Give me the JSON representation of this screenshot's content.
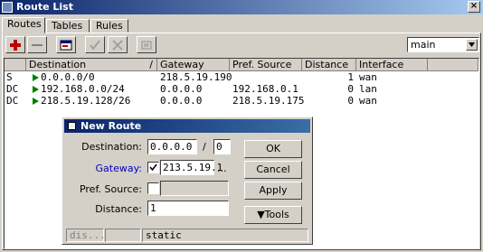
{
  "window": {
    "title": "Route List"
  },
  "tabs": [
    {
      "label": "Routes"
    },
    {
      "label": "Tables"
    },
    {
      "label": "Rules"
    }
  ],
  "toolbar": {
    "filter_value": "main"
  },
  "table": {
    "columns": [
      "Destination",
      "Gateway",
      "Pref. Source",
      "Distance",
      "Interface"
    ],
    "rows": [
      {
        "flag": "S",
        "destination": "0.0.0.0/0",
        "gateway": "218.5.19.190",
        "pref_source": "",
        "distance": "1",
        "interface": "wan"
      },
      {
        "flag": "DC",
        "destination": "192.168.0.0/24",
        "gateway": "0.0.0.0",
        "pref_source": "192.168.0.1",
        "distance": "0",
        "interface": "lan"
      },
      {
        "flag": "DC",
        "destination": "218.5.19.128/26",
        "gateway": "0.0.0.0",
        "pref_source": "218.5.19.175",
        "distance": "0",
        "interface": "wan"
      }
    ]
  },
  "dialog": {
    "title": "New Route",
    "destination_label": "Destination:",
    "destination_ip": "0.0.0.0",
    "destination_slash": "/",
    "destination_mask": "0",
    "gateway_label": "Gateway:",
    "gateway_value": "213.5.19.1",
    "gateway_more": "...",
    "pref_source_label": "Pref. Source:",
    "pref_source_value": "",
    "distance_label": "Distance:",
    "distance_value": "1",
    "ok_label": "OK",
    "cancel_label": "Cancel",
    "apply_label": "Apply",
    "tools_label": "▼Tools",
    "status_left": "dis...",
    "status_right": "static"
  },
  "colors": {
    "title_bar": "#0a246a",
    "gateway_label": "#0000c0",
    "add_icon": "#c00000",
    "route_arrow": "#008000"
  }
}
